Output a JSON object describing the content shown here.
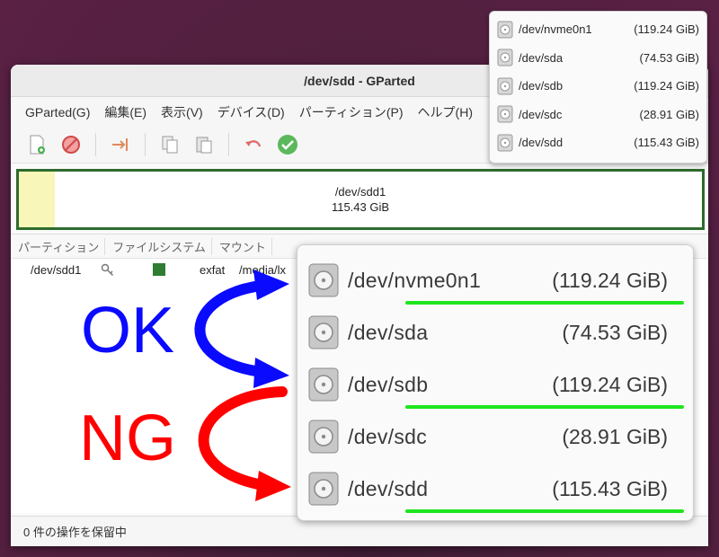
{
  "window": {
    "title": "/dev/sdd - GParted"
  },
  "menu": [
    "GParted(G)",
    "編集(E)",
    "表示(V)",
    "デバイス(D)",
    "パーティション(P)",
    "ヘルプ(H)"
  ],
  "toolbar": [
    "new-partition-icon",
    "delete-icon",
    "resize-move-icon",
    "copy-icon",
    "paste-icon",
    "undo-icon",
    "apply-icon"
  ],
  "disk_map": {
    "name": "/dev/sdd1",
    "size": "115.43 GiB",
    "border_color": "#2e6b2e",
    "used_color": "#f8f6b8"
  },
  "table": {
    "headers": [
      "パーティション",
      "ファイルシステム",
      "マウント"
    ],
    "rows": [
      {
        "partition": "/dev/sdd1",
        "filesystem": "exfat",
        "mount": "/media/lx",
        "fs_color": "#2e7d32"
      }
    ]
  },
  "status": "0 件の操作を保留中",
  "devices_small": [
    {
      "name": "/dev/nvme0n1",
      "size": "(119.24 GiB)"
    },
    {
      "name": "/dev/sda",
      "size": "(74.53 GiB)"
    },
    {
      "name": "/dev/sdb",
      "size": "(119.24 GiB)"
    },
    {
      "name": "/dev/sdc",
      "size": "(28.91 GiB)"
    },
    {
      "name": "/dev/sdd",
      "size": "(115.43 GiB)"
    }
  ],
  "devices_big": [
    {
      "name": "/dev/nvme0n1",
      "size": "(119.24 GiB)",
      "underlined": true
    },
    {
      "name": "/dev/sda",
      "size": "(74.53 GiB)",
      "underlined": false
    },
    {
      "name": "/dev/sdb",
      "size": "(119.24 GiB)",
      "underlined": true
    },
    {
      "name": "/dev/sdc",
      "size": "(28.91 GiB)",
      "underlined": false
    },
    {
      "name": "/dev/sdd",
      "size": "(115.43 GiB)",
      "underlined": true
    }
  ],
  "annotations": {
    "ok": "OK",
    "ng": "NG",
    "ok_color": "#0a0aff",
    "ng_color": "#ff0000",
    "underline_color": "#1ee61e"
  }
}
